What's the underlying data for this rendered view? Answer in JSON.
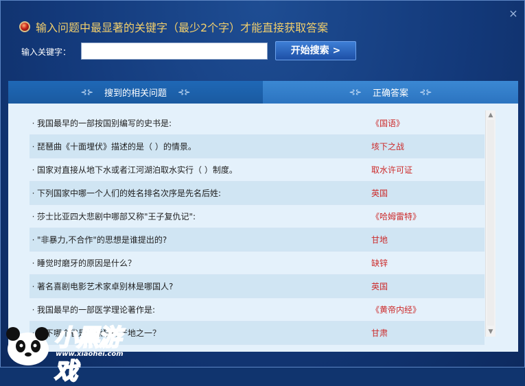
{
  "header": {
    "title": "输入问题中最显著的关键字（最少2个字）才能直接获取答案",
    "close_label": "×"
  },
  "search": {
    "label": "输入关键字：",
    "value": "",
    "placeholder": "",
    "button_label": "开始搜索 >"
  },
  "tabs": [
    {
      "label": "搜到的相关问题"
    },
    {
      "label": "正确答案"
    }
  ],
  "results": [
    {
      "question": "我国最早的一部按国别编写的史书是:",
      "answer": "《国语》"
    },
    {
      "question": "琵琶曲《十面埋伏》描述的是（ ）的情景。",
      "answer": "垓下之战"
    },
    {
      "question": "国家对直接从地下水或者江河湖泊取水实行（ ）制度。",
      "answer": "取水许可证"
    },
    {
      "question": "下列国家中哪一个人们的姓名排名次序是先名后姓:",
      "answer": "英国"
    },
    {
      "question": "莎士比亚四大悲剧中哪部又称\"王子复仇记\":",
      "answer": "《哈姆雷特》"
    },
    {
      "question": "\"非暴力,不合作\"的思想是谁提出的?",
      "answer": "甘地"
    },
    {
      "question": "睡觉时磨牙的原因是什么？",
      "answer": "缺锌"
    },
    {
      "question": "著名喜剧电影艺术家卓别林是哪国人?",
      "answer": "英国"
    },
    {
      "question": "我国最早的一部医学理论著作是:",
      "answer": "《黄帝内经》"
    },
    {
      "question": "以下哪个省是大熊猫的产地之一？",
      "answer": "甘肃"
    }
  ],
  "watermark": {
    "logo_text": "小黑游戏",
    "url": "www.xiaohei.com"
  },
  "colors": {
    "title": "#f2cf6c",
    "answer": "#cc2a2a",
    "panel": "#e4f1fb"
  }
}
